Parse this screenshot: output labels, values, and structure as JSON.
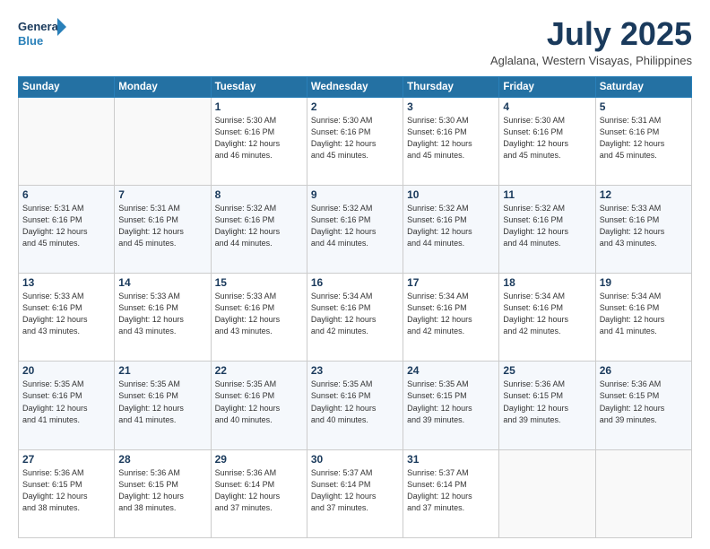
{
  "logo": {
    "line1": "General",
    "line2": "Blue"
  },
  "header": {
    "month": "July 2025",
    "location": "Aglalana, Western Visayas, Philippines"
  },
  "weekdays": [
    "Sunday",
    "Monday",
    "Tuesday",
    "Wednesday",
    "Thursday",
    "Friday",
    "Saturday"
  ],
  "weeks": [
    [
      {
        "day": "",
        "info": ""
      },
      {
        "day": "",
        "info": ""
      },
      {
        "day": "1",
        "info": "Sunrise: 5:30 AM\nSunset: 6:16 PM\nDaylight: 12 hours\nand 46 minutes."
      },
      {
        "day": "2",
        "info": "Sunrise: 5:30 AM\nSunset: 6:16 PM\nDaylight: 12 hours\nand 45 minutes."
      },
      {
        "day": "3",
        "info": "Sunrise: 5:30 AM\nSunset: 6:16 PM\nDaylight: 12 hours\nand 45 minutes."
      },
      {
        "day": "4",
        "info": "Sunrise: 5:30 AM\nSunset: 6:16 PM\nDaylight: 12 hours\nand 45 minutes."
      },
      {
        "day": "5",
        "info": "Sunrise: 5:31 AM\nSunset: 6:16 PM\nDaylight: 12 hours\nand 45 minutes."
      }
    ],
    [
      {
        "day": "6",
        "info": "Sunrise: 5:31 AM\nSunset: 6:16 PM\nDaylight: 12 hours\nand 45 minutes."
      },
      {
        "day": "7",
        "info": "Sunrise: 5:31 AM\nSunset: 6:16 PM\nDaylight: 12 hours\nand 45 minutes."
      },
      {
        "day": "8",
        "info": "Sunrise: 5:32 AM\nSunset: 6:16 PM\nDaylight: 12 hours\nand 44 minutes."
      },
      {
        "day": "9",
        "info": "Sunrise: 5:32 AM\nSunset: 6:16 PM\nDaylight: 12 hours\nand 44 minutes."
      },
      {
        "day": "10",
        "info": "Sunrise: 5:32 AM\nSunset: 6:16 PM\nDaylight: 12 hours\nand 44 minutes."
      },
      {
        "day": "11",
        "info": "Sunrise: 5:32 AM\nSunset: 6:16 PM\nDaylight: 12 hours\nand 44 minutes."
      },
      {
        "day": "12",
        "info": "Sunrise: 5:33 AM\nSunset: 6:16 PM\nDaylight: 12 hours\nand 43 minutes."
      }
    ],
    [
      {
        "day": "13",
        "info": "Sunrise: 5:33 AM\nSunset: 6:16 PM\nDaylight: 12 hours\nand 43 minutes."
      },
      {
        "day": "14",
        "info": "Sunrise: 5:33 AM\nSunset: 6:16 PM\nDaylight: 12 hours\nand 43 minutes."
      },
      {
        "day": "15",
        "info": "Sunrise: 5:33 AM\nSunset: 6:16 PM\nDaylight: 12 hours\nand 43 minutes."
      },
      {
        "day": "16",
        "info": "Sunrise: 5:34 AM\nSunset: 6:16 PM\nDaylight: 12 hours\nand 42 minutes."
      },
      {
        "day": "17",
        "info": "Sunrise: 5:34 AM\nSunset: 6:16 PM\nDaylight: 12 hours\nand 42 minutes."
      },
      {
        "day": "18",
        "info": "Sunrise: 5:34 AM\nSunset: 6:16 PM\nDaylight: 12 hours\nand 42 minutes."
      },
      {
        "day": "19",
        "info": "Sunrise: 5:34 AM\nSunset: 6:16 PM\nDaylight: 12 hours\nand 41 minutes."
      }
    ],
    [
      {
        "day": "20",
        "info": "Sunrise: 5:35 AM\nSunset: 6:16 PM\nDaylight: 12 hours\nand 41 minutes."
      },
      {
        "day": "21",
        "info": "Sunrise: 5:35 AM\nSunset: 6:16 PM\nDaylight: 12 hours\nand 41 minutes."
      },
      {
        "day": "22",
        "info": "Sunrise: 5:35 AM\nSunset: 6:16 PM\nDaylight: 12 hours\nand 40 minutes."
      },
      {
        "day": "23",
        "info": "Sunrise: 5:35 AM\nSunset: 6:16 PM\nDaylight: 12 hours\nand 40 minutes."
      },
      {
        "day": "24",
        "info": "Sunrise: 5:35 AM\nSunset: 6:15 PM\nDaylight: 12 hours\nand 39 minutes."
      },
      {
        "day": "25",
        "info": "Sunrise: 5:36 AM\nSunset: 6:15 PM\nDaylight: 12 hours\nand 39 minutes."
      },
      {
        "day": "26",
        "info": "Sunrise: 5:36 AM\nSunset: 6:15 PM\nDaylight: 12 hours\nand 39 minutes."
      }
    ],
    [
      {
        "day": "27",
        "info": "Sunrise: 5:36 AM\nSunset: 6:15 PM\nDaylight: 12 hours\nand 38 minutes."
      },
      {
        "day": "28",
        "info": "Sunrise: 5:36 AM\nSunset: 6:15 PM\nDaylight: 12 hours\nand 38 minutes."
      },
      {
        "day": "29",
        "info": "Sunrise: 5:36 AM\nSunset: 6:14 PM\nDaylight: 12 hours\nand 37 minutes."
      },
      {
        "day": "30",
        "info": "Sunrise: 5:37 AM\nSunset: 6:14 PM\nDaylight: 12 hours\nand 37 minutes."
      },
      {
        "day": "31",
        "info": "Sunrise: 5:37 AM\nSunset: 6:14 PM\nDaylight: 12 hours\nand 37 minutes."
      },
      {
        "day": "",
        "info": ""
      },
      {
        "day": "",
        "info": ""
      }
    ]
  ]
}
